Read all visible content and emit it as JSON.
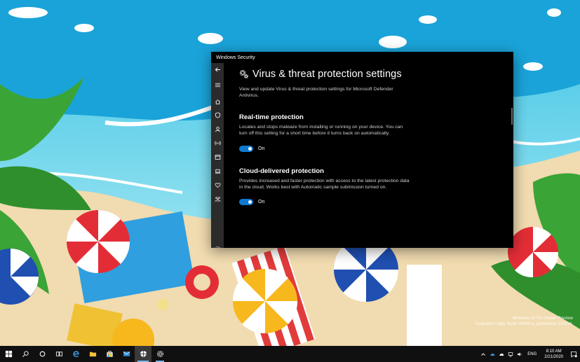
{
  "window": {
    "title": "Windows Security"
  },
  "page": {
    "title": "Virus & threat protection settings",
    "subtitle": "View and update Virus & threat protection settings for Microsoft Defender Antivirus."
  },
  "sections": [
    {
      "heading": "Real-time protection",
      "description": "Locates and stops malware from installing or running on your device. You can turn off this setting for a short time before it turns back on automatically.",
      "toggle_state": "On"
    },
    {
      "heading": "Cloud-delivered protection",
      "description": "Provides increased and faster protection with access to the latest protection data in the cloud. Works best with Automatic sample submission turned on.",
      "toggle_state": "On"
    }
  ],
  "nav_icons": [
    "back-arrow-icon",
    "hamburger-menu-icon",
    "home-icon",
    "shield-icon",
    "person-icon",
    "wireless-icon",
    "app-browser-icon",
    "laptop-icon",
    "heart-icon",
    "family-icon",
    "settings-gear-icon"
  ],
  "watermark": {
    "line1": "Windows 10 Pro Insider Preview",
    "line2": "Evaluation copy. Build 19569.rs_prerelease.200214-"
  },
  "taskbar": {
    "language": "ENG",
    "time": "8:10 AM",
    "date": "2/21/2020"
  },
  "colors": {
    "accent": "#0e7ad1",
    "window_bg": "#000000",
    "nav_bg": "#2b2b2b",
    "taskbar_bg": "#101010"
  }
}
